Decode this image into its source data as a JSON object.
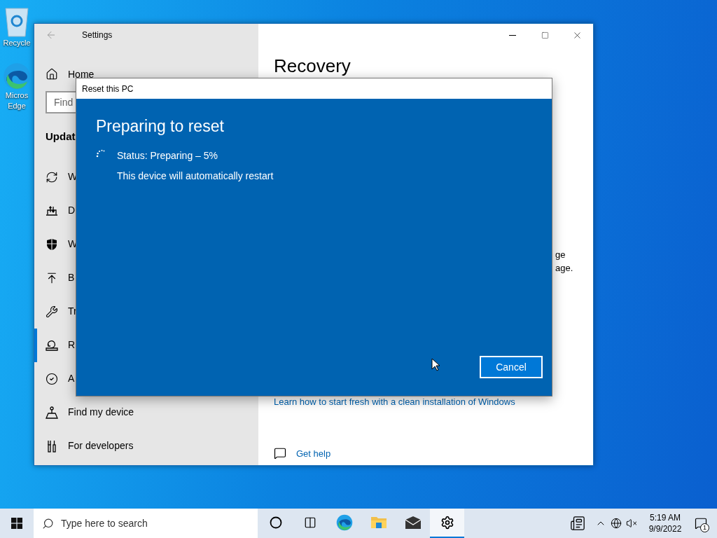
{
  "desktop_icons": [
    {
      "kind": "recycle-bin",
      "label": [
        "Recycle"
      ]
    },
    {
      "kind": "edge",
      "label": [
        "Micros",
        "Edge"
      ]
    }
  ],
  "settings_window": {
    "title": "Settings",
    "sidebar": {
      "home": "Home",
      "search": {
        "placeholder": "Find"
      },
      "heading": "Updat",
      "items": [
        {
          "kind": "sync",
          "label": "W",
          "selected": false
        },
        {
          "kind": "delivery",
          "label": "D",
          "selected": false
        },
        {
          "kind": "shield",
          "label": "W",
          "selected": false
        },
        {
          "kind": "backup",
          "label": "B",
          "selected": false
        },
        {
          "kind": "wrench",
          "label": "Tr",
          "selected": false
        },
        {
          "kind": "recovery",
          "label": "R",
          "selected": true
        },
        {
          "kind": "activation",
          "label": "A",
          "selected": false
        },
        {
          "kind": "find-device",
          "label": "Find my device",
          "selected": false
        },
        {
          "kind": "developers",
          "label": "For developers",
          "selected": false
        }
      ]
    },
    "content": {
      "heading": "Recovery",
      "fragments": [
        "ge",
        "age."
      ],
      "link": "Learn how to start fresh with a clean installation of Windows",
      "help": "Get help"
    }
  },
  "dialog": {
    "title": "Reset this PC",
    "heading": "Preparing to reset",
    "status": "Status: Preparing – 5%",
    "note": "This device will automatically restart",
    "button": "Cancel"
  },
  "taskbar": {
    "search": {
      "placeholder": "Type here to search"
    },
    "apps": [
      {
        "kind": "cortana",
        "selected": false
      },
      {
        "kind": "task-view",
        "selected": false
      },
      {
        "kind": "edge",
        "selected": false
      },
      {
        "kind": "explorer",
        "selected": false
      },
      {
        "kind": "mail",
        "selected": false
      },
      {
        "kind": "settings",
        "selected": true
      }
    ],
    "time": "5:19 AM",
    "date": "9/9/2022",
    "notifications": "1"
  }
}
